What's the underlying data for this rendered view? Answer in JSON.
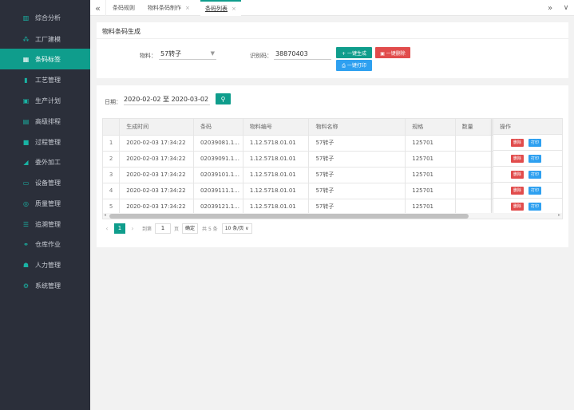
{
  "sidebar": {
    "items": [
      {
        "label": "综合分析",
        "icon": "bar-chart-icon",
        "glyph": "▥"
      },
      {
        "label": "工厂建模",
        "icon": "sitemap-icon",
        "glyph": "⁂"
      },
      {
        "label": "条码标签",
        "icon": "barcode-icon",
        "glyph": "▦"
      },
      {
        "label": "工艺管理",
        "icon": "document-icon",
        "glyph": "▮"
      },
      {
        "label": "生产计划",
        "icon": "calendar-icon",
        "glyph": "▣"
      },
      {
        "label": "高级排程",
        "icon": "schedule-icon",
        "glyph": "▤"
      },
      {
        "label": "过程管理",
        "icon": "process-icon",
        "glyph": "■"
      },
      {
        "label": "委外加工",
        "icon": "outsource-icon",
        "glyph": "◢"
      },
      {
        "label": "设备管理",
        "icon": "monitor-icon",
        "glyph": "▭"
      },
      {
        "label": "质量管理",
        "icon": "quality-search-icon",
        "glyph": "◎"
      },
      {
        "label": "追溯管理",
        "icon": "trace-icon",
        "glyph": "☰"
      },
      {
        "label": "仓库作业",
        "icon": "warehouse-icon",
        "glyph": "⚭"
      },
      {
        "label": "人力管理",
        "icon": "users-icon",
        "glyph": "☗"
      },
      {
        "label": "系统管理",
        "icon": "gears-icon",
        "glyph": "⚙"
      }
    ],
    "active_index": 2,
    "accent": "#0f9d8c",
    "bg": "#2b2f3a"
  },
  "topbar": {
    "tabs": [
      {
        "label": "条码规则"
      },
      {
        "label": "物料条码制作"
      },
      {
        "label": "条码列表"
      }
    ],
    "left_icon": "«",
    "right_icon": "»",
    "dropdown_icon": "∨",
    "close_icon": "×"
  },
  "gen_card": {
    "title": "物料条码生成",
    "material_label": "物料：",
    "material_value": "57转子",
    "id_label": "识别码：",
    "id_value": "38870403",
    "btn_generate": "+ 一键生成",
    "btn_delete": "▣ 一键删除",
    "btn_print": "⎙ 一键打印"
  },
  "list_card": {
    "date_label": "日期：",
    "date_value": "2020-02-02 至 2020-03-02",
    "search_icon": "🔍",
    "columns": [
      "",
      "生成时间",
      "条码",
      "物料编号",
      "物料名称",
      "规格",
      "数量"
    ],
    "op_header": "操作",
    "rows": [
      [
        "1",
        "2020-02-03 17:34:22",
        "02039081.1...",
        "1.12.5718.01.01",
        "57转子",
        "125701",
        ""
      ],
      [
        "2",
        "2020-02-03 17:34:22",
        "02039091.1...",
        "1.12.5718.01.01",
        "57转子",
        "125701",
        ""
      ],
      [
        "3",
        "2020-02-03 17:34:22",
        "02039101.1...",
        "1.12.5718.01.01",
        "57转子",
        "125701",
        ""
      ],
      [
        "4",
        "2020-02-03 17:34:22",
        "02039111.1...",
        "1.12.5718.01.01",
        "57转子",
        "125701",
        ""
      ],
      [
        "5",
        "2020-02-03 17:34:22",
        "02039121.1...",
        "1.12.5718.01.01",
        "57转子",
        "125701",
        ""
      ]
    ],
    "op_delete": "删除",
    "op_print": "打印"
  },
  "pager": {
    "prev": "‹",
    "current": "1",
    "next": "›",
    "goto_label": "到第",
    "goto_value": "1",
    "page_unit": "页",
    "confirm": "确定",
    "total": "共 5 条",
    "page_size": "10 条/页 ∨"
  }
}
